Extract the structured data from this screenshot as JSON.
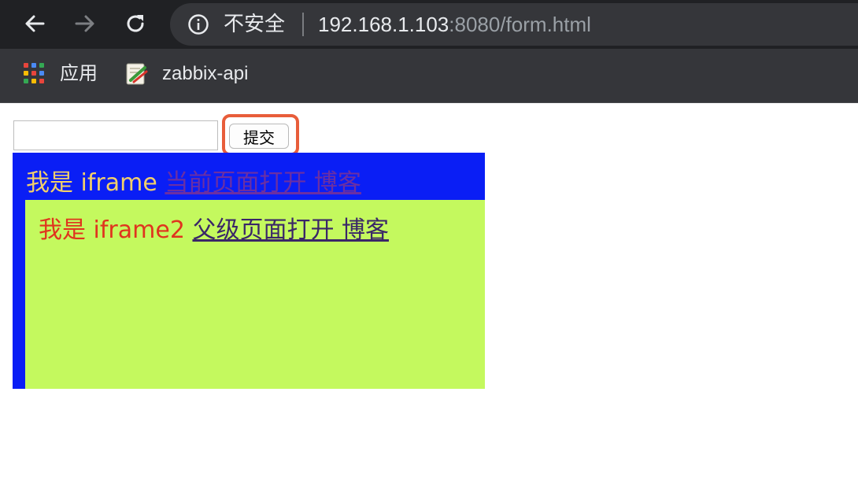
{
  "browser": {
    "security_label": "不安全",
    "url_host": "192.168.1.103",
    "url_rest": ":8080/form.html",
    "bookmarks": [
      {
        "label": "应用",
        "icon": "apps-grid-icon"
      },
      {
        "label": "zabbix-api",
        "icon": "zabbix-bookmark-icon"
      }
    ]
  },
  "form": {
    "input_value": "",
    "submit_label": "提交"
  },
  "iframe1": {
    "label": "我是 iframe",
    "link": "当前页面打开 博客",
    "bg_color": "#0a1ef5"
  },
  "iframe2": {
    "label": "我是 iframe2",
    "link": "父级页面打开 博客",
    "bg_color": "#c4f95e"
  },
  "colors": {
    "highlight": "#e85d3a",
    "chrome_dark": "#202124"
  }
}
